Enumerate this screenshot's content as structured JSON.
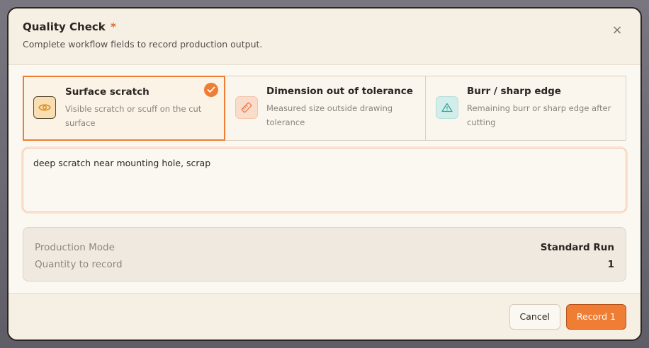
{
  "dialog": {
    "title": "Quality Check",
    "required_mark": "*",
    "subtitle": "Complete workflow fields to record production output.",
    "close_symbol": "×"
  },
  "options": [
    {
      "title": "Surface scratch",
      "description": "Visible scratch or scuff on the cut surface",
      "icon": "eye-icon",
      "selected": true
    },
    {
      "title": "Dimension out of tolerance",
      "description": "Measured size outside drawing tolerance",
      "icon": "ruler-icon",
      "selected": false
    },
    {
      "title": "Burr / sharp edge",
      "description": "Remaining burr or sharp edge after cutting",
      "icon": "warning-triangle-icon",
      "selected": false
    }
  ],
  "notes": {
    "value": "deep scratch near mounting hole, scrap"
  },
  "summary": {
    "mode_label": "Production Mode",
    "mode_value": "Standard Run",
    "qty_label": "Quantity to record",
    "qty_value": "1"
  },
  "footer": {
    "cancel_label": "Cancel",
    "record_label": "Record 1"
  },
  "colors": {
    "accent": "#ef7d34",
    "background": "#f5efe4"
  }
}
